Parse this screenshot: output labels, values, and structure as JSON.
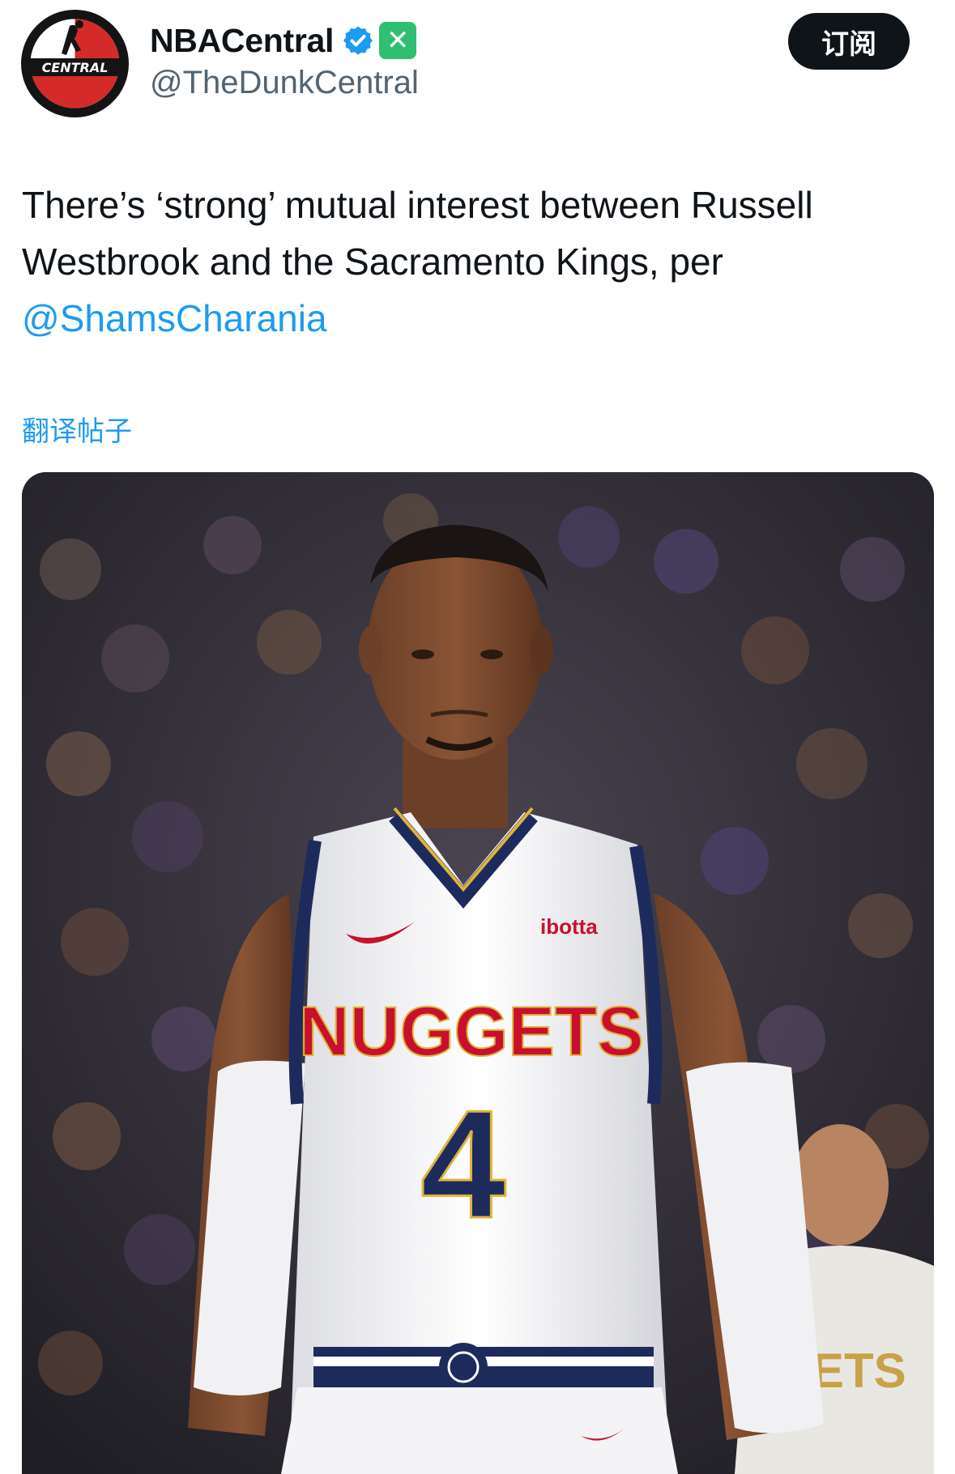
{
  "author": {
    "display_name": "NBACentral",
    "handle": "@TheDunkCentral",
    "avatar_text": "CENTRAL",
    "verified_icon": "verified-badge-icon",
    "affiliate_icon": "x-affiliate-badge-icon",
    "badge_color": "#1d9bf0",
    "affiliate_color": "#2fbf71"
  },
  "actions": {
    "subscribe_label": "订阅"
  },
  "tweet": {
    "text_before": "There’s ‘strong’ mutual interest between Russell Westbrook and the Sacramento Kings, per ",
    "mention": "@ShamsCharania",
    "translate_label": "翻译帖子"
  },
  "media": {
    "type": "photo",
    "jersey_sponsor": "ibotta",
    "jersey_team": "NUGGETS",
    "jersey_number": "4",
    "background_jersey_text": "ETS"
  },
  "colors": {
    "link": "#1d9bf0",
    "text": "#0f1419",
    "secondary": "#536471"
  }
}
